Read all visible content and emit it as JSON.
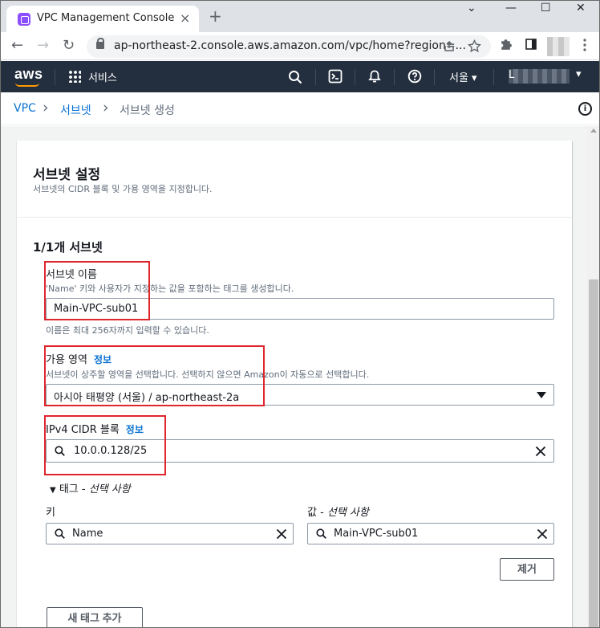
{
  "browser": {
    "tab_title": "VPC Management Console",
    "tab_close": "×",
    "new_tab": "+",
    "window_controls": {
      "minimize": "—",
      "maximize": "☐",
      "close": "✕",
      "dropdown": "⌄"
    },
    "url": "ap-northeast-2.console.aws.amazon.com/vpc/home?region=...",
    "nav": {
      "back": "←",
      "forward": "→",
      "reload": "↻"
    }
  },
  "aws_nav": {
    "logo": "aws",
    "services": "서비스",
    "region": "서울 ▾",
    "account_initial": "L",
    "account_caret": "▾"
  },
  "breadcrumb": {
    "items": [
      "VPC",
      "서브넷",
      "서브넷 생성"
    ],
    "separator": "›"
  },
  "panel": {
    "title": "서브넷 설정",
    "description": "서브넷의 CIDR 블록 및 가용 영역을 지정합니다."
  },
  "subnet": {
    "section_title": "1/1개 서브넷",
    "name": {
      "label": "서브넷 이름",
      "description_quoted": "'Name'",
      "description_rest": " 키와 사용자가 지정하는 값을 포함하는 태그를 생성합니다.",
      "value": "Main-VPC-sub01",
      "constraint": "이름은 최대 256자까지 입력할 수 있습니다."
    },
    "az": {
      "label": "가용 영역",
      "info": "정보",
      "description": "서브넷이 상주할 영역을 선택합니다. 선택하지 않으면 Amazon이 자동으로 선택합니다.",
      "value": "아시아 태평양 (서울) / ap-northeast-2a"
    },
    "cidr": {
      "label": "IPv4 CIDR 블록",
      "info": "정보",
      "value": "10.0.0.128/25"
    },
    "tags": {
      "toggle_label": "태그 - ",
      "toggle_label_optional": "선택 사항",
      "key_header": "키",
      "value_header_prefix": "값 - ",
      "value_header_optional": "선택 사항",
      "key_value": "Name",
      "value_value": "Main-VPC-sub01",
      "remove_button": "제거",
      "add_button": "새 태그 추가"
    }
  },
  "colors": {
    "aws_nav_bg": "#232f3e",
    "link_blue": "#0972d3",
    "highlight_red": "#e0262d",
    "aws_orange": "#ff9900"
  }
}
